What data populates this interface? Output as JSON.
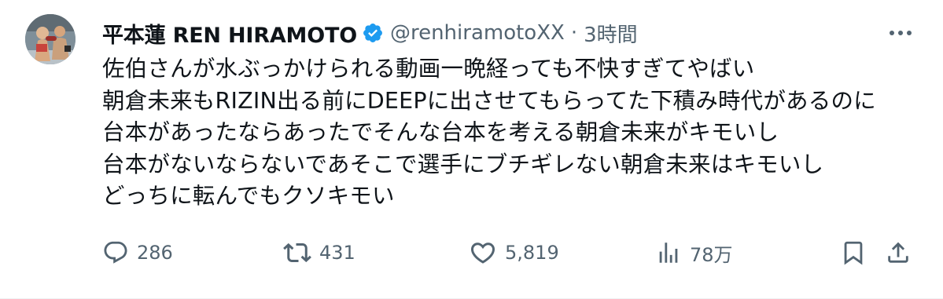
{
  "tweet": {
    "author": {
      "display_name": "平本蓮 REN HIRAMOTO",
      "handle": "@renhiramotoXX",
      "verified": true
    },
    "separator": "·",
    "time": "3時間",
    "body_lines": [
      "佐伯さんが水ぶっかけられる動画一晩経っても不快すぎてやばい",
      "朝倉未来もRIZIN出る前にDEEPに出させてもらってた下積み時代があるのに",
      "台本があったならあったでそんな台本を考える朝倉未来がキモいし",
      "台本がないならないであそこで選手にブチギレない朝倉未来はキモいし",
      "どっちに転んでもクソキモい"
    ],
    "actions": {
      "reply": {
        "icon": "reply-icon",
        "count": "286"
      },
      "retweet": {
        "icon": "retweet-icon",
        "count": "431"
      },
      "like": {
        "icon": "heart-icon",
        "count": "5,819"
      },
      "views": {
        "icon": "views-icon",
        "count": "78万"
      },
      "bookmark": {
        "icon": "bookmark-icon"
      },
      "share": {
        "icon": "share-icon"
      }
    }
  },
  "colors": {
    "text_primary": "#0f1419",
    "text_secondary": "#536471",
    "verified_blue": "#1d9bf0",
    "border": "#eff3f4"
  }
}
